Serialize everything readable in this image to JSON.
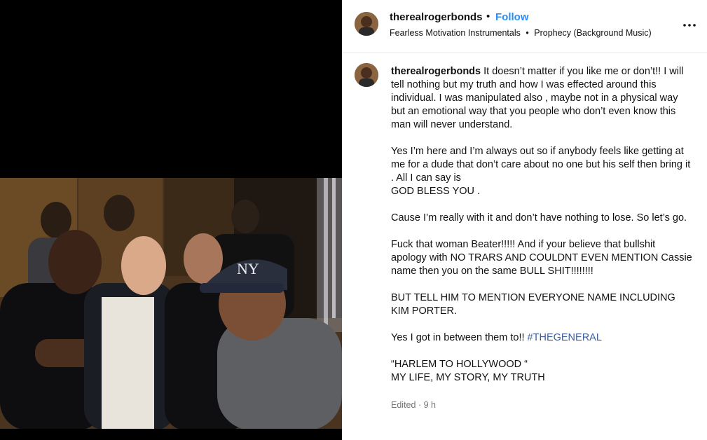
{
  "header": {
    "username": "therealrogerbonds",
    "separator": "•",
    "follow_label": "Follow",
    "audio_artist": "Fearless Motivation Instrumentals",
    "audio_separator": "•",
    "audio_track": "Prophecy (Background Music)",
    "more_icon": "more-horizontal-icon"
  },
  "caption": {
    "username": "therealrogerbonds",
    "para1": "It doesn’t matter if you like me or don’t!! I will tell nothing but my truth and how I was effected around this individual. I was manipulated also , maybe not in a physical way but an emotional way that you people who don’t even know this man will never understand.",
    "para2a": "Yes I’m here and I’m always out so if anybody feels like getting at me for a dude that don’t care about no one but his self then bring it . All I can say is",
    "para2b": "GOD BLESS YOU .",
    "para3": "Cause I’m really with it and don’t have nothing to lose. So let’s go.",
    "para4": "Fuck that woman Beater!!!!! And if your believe that bullshit apology with NO TRARS AND COULDNT EVEN MENTION Cassie name then you on the same BULL SHIT!!!!!!!!",
    "para5": "BUT TELL HIM TO MENTION EVERYONE NAME INCLUDING KIM PORTER.",
    "para6": "Yes I got in between them to!!",
    "hashtag": "#THEGENERAL",
    "para7a": "“HARLEM TO HOLLYWOOD “",
    "para7b": "MY LIFE, MY STORY, MY TRUTH"
  },
  "meta": {
    "edited": "Edited",
    "separator": "·",
    "time": "9 h"
  },
  "colors": {
    "accent": "#2b8ef0",
    "hashtag": "#3b5b9a",
    "muted": "#737373"
  }
}
